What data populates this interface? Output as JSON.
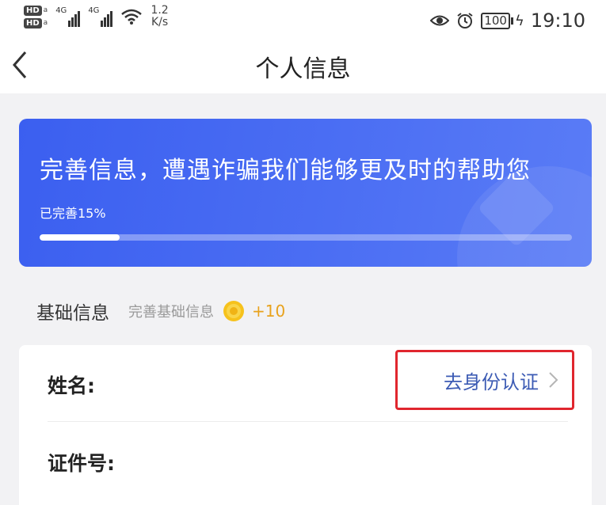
{
  "status_bar": {
    "sim1_label": "HD",
    "sim2_label": "HD",
    "sim_sub": "a",
    "sig1_label": "4G",
    "sig2_label": "4G",
    "net_speed_value": "1.2",
    "net_speed_unit": "K/s",
    "battery": "100",
    "time": "19:10"
  },
  "nav": {
    "title": "个人信息"
  },
  "banner": {
    "title": "完善信息，遭遇诈骗我们能够更及时的帮助您",
    "progress_text": "已完善15%",
    "progress_fraction": 0.15,
    "color": "#4264f2"
  },
  "section": {
    "title": "基础信息",
    "hint": "完善基础信息",
    "points": "+10"
  },
  "form": {
    "name_label": "姓名:",
    "verify_label": "去身份认证",
    "id_label": "证件号:"
  },
  "icons": [
    "back-icon",
    "eye-icon",
    "alarm-icon",
    "wifi-icon",
    "coin-icon",
    "chevron-right-icon"
  ],
  "colors": {
    "accent_link": "#3c5bb4",
    "highlight_box": "#e0262e",
    "points": "#e8a21c"
  }
}
